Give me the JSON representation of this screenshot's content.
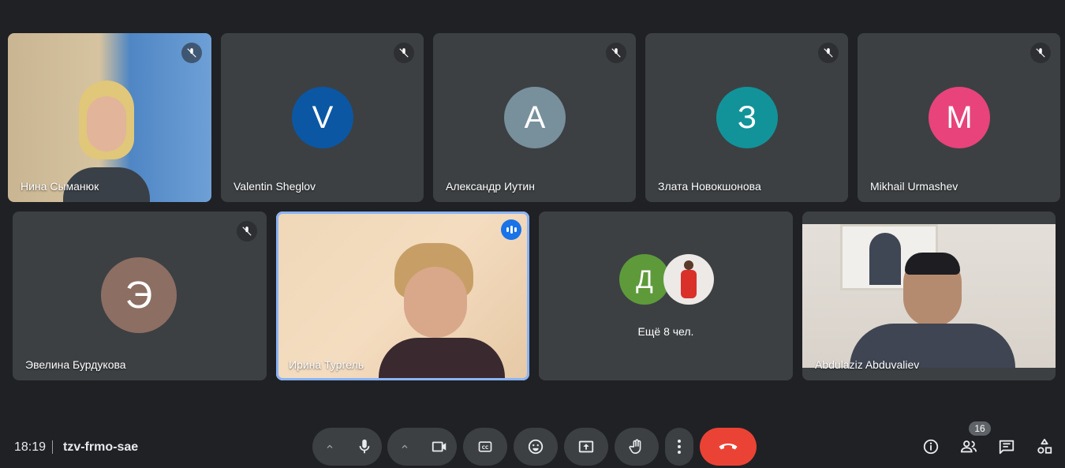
{
  "participants": [
    {
      "name": "Нина Сыманюк"
    },
    {
      "name": "Valentin Sheglov",
      "initial": "V",
      "color": "#0b57a4"
    },
    {
      "name": "Александр Иутин",
      "initial": "A",
      "color": "#78909c"
    },
    {
      "name": "Злата Новокшонова",
      "initial": "З",
      "color": "#12939a"
    },
    {
      "name": "Mikhail Urmashev",
      "initial": "M",
      "color": "#e8437a"
    },
    {
      "name": "Эвелина Бурдукова",
      "initial": "Э",
      "color": "#8d6e63"
    },
    {
      "name": "Ирина Тургель"
    },
    {
      "name": "Abdulaziz Abduvaliev"
    }
  ],
  "overflow": {
    "label": "Ещё 8 чел.",
    "initial": "Д",
    "initial_color": "#5e9a3a"
  },
  "meeting": {
    "time": "18:19",
    "code": "tzv-frmo-sae"
  },
  "people_count": "16",
  "colors": {
    "end_call": "#ea4335",
    "speaking": "#1a73e8",
    "background": "#202124",
    "tile": "#3c4043"
  }
}
